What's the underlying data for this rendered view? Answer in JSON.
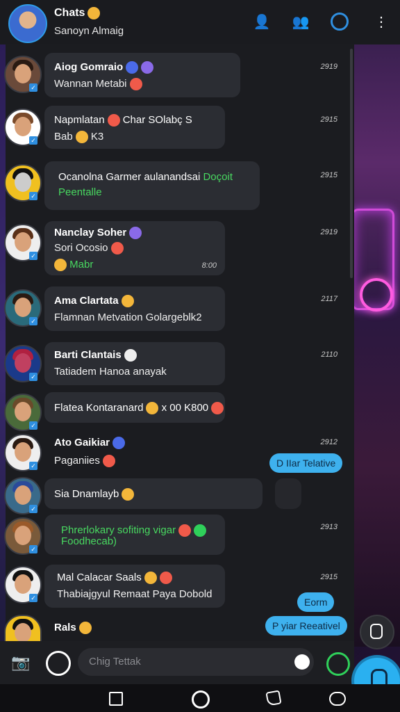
{
  "header": {
    "title": "Chats",
    "subtitle": "Sanoyn Almaig",
    "icons": [
      "add-contact-icon",
      "group-icon",
      "status-icon",
      "more-icon"
    ]
  },
  "chats": [
    {
      "name": "Aiog Gomraio",
      "message": "Wannan Metabi",
      "time": "2919",
      "message_green": false
    },
    {
      "name": "Napmlatan",
      "name_extra": "Char SOlabç S",
      "message": "Bab",
      "message_tail": "K3",
      "time": "2915"
    },
    {
      "name": "Ocanolna Garmer aulanandsai",
      "name_green_tail": "Doçoit",
      "message": "Peentalle",
      "message_green": true,
      "time": "2915"
    },
    {
      "name": "Nanclay Soher",
      "message": "Sori Ocosio",
      "message2": "Mabr",
      "message2_green": true,
      "aux": "8:00",
      "time": "2919"
    },
    {
      "name": "Ama Clartata",
      "message": "Flamnan Metvation Golargeblk2",
      "time": "2117"
    },
    {
      "name": "Barti Clantais",
      "message": "Tatiadem Hanoa anayak",
      "time": "2110"
    },
    {
      "name": "Flatea Kontaranard",
      "message_tail": "x 00 K800",
      "time": ""
    },
    {
      "name": "Ato Gaikiar",
      "message": "Paganiies",
      "time": "2912",
      "pill": "D IIar Telative"
    },
    {
      "name": "Sia Dnamlayb",
      "time": ""
    },
    {
      "name": "Phrerlokary sofiting vigar",
      "message": "Foodhecab)",
      "message_green": true,
      "time": "2913"
    },
    {
      "name": "Mal Calacar Saals",
      "message": "Thabiajgyul Remaat Paya Dobold",
      "time": "2915",
      "pill": "Eorm"
    },
    {
      "name": "Rals",
      "time": "",
      "pill": "P yiar Reeativel"
    }
  ],
  "composer": {
    "placeholder": "Chig Tettak"
  },
  "colors": {
    "accent": "#3eb1ee",
    "panel": "#1b1c20",
    "bubble": "#2b2d33",
    "green": "#48d860"
  }
}
